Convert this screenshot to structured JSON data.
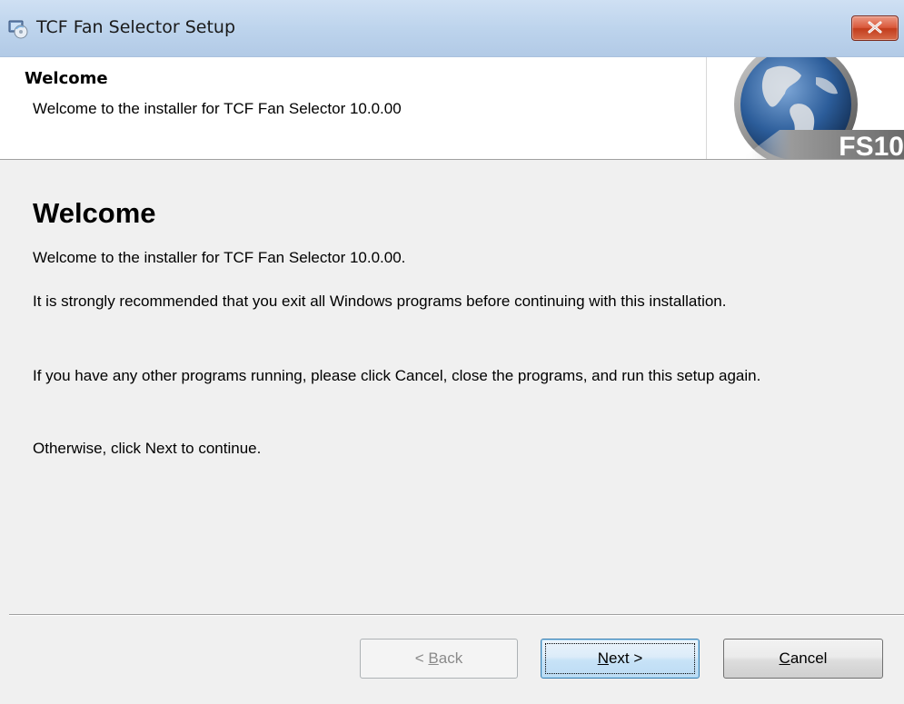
{
  "window": {
    "title": "TCF Fan Selector Setup"
  },
  "header": {
    "title": "Welcome",
    "subtitle": "Welcome to the installer for TCF Fan Selector 10.0.00",
    "logo_text": "FS10"
  },
  "body": {
    "heading": "Welcome",
    "paragraphs": [
      "Welcome to the installer for TCF Fan Selector 10.0.00.",
      "It is strongly recommended that you exit all Windows programs before continuing with this installation.",
      "If you have any other programs running, please click Cancel, close the programs, and run this setup again.",
      "Otherwise, click Next to continue."
    ]
  },
  "buttons": {
    "back": {
      "label": "< Back",
      "accel": "B",
      "pre": "< ",
      "post": "ack",
      "enabled": false
    },
    "next": {
      "label": "Next >",
      "accel": "N",
      "pre": "",
      "post": "ext >",
      "enabled": true
    },
    "cancel": {
      "label": "Cancel",
      "accel": "C",
      "pre": "",
      "post": "ancel",
      "enabled": true
    }
  },
  "icons": {
    "app": "installer-disc-icon",
    "close": "close-icon",
    "logo": "globe-logo"
  },
  "colors": {
    "close_button": "#c23c1c",
    "titlebar": "#bcd3ec",
    "focused_button_border": "#3c7fb1"
  }
}
